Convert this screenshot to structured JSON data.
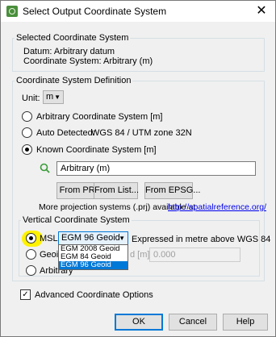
{
  "window": {
    "title": "Select Output Coordinate System",
    "close_glyph": "✕"
  },
  "selected_cs": {
    "legend": "Selected Coordinate System",
    "datum": "Datum: Arbitrary datum",
    "cs": "Coordinate System: Arbitrary (m)"
  },
  "definition": {
    "legend": "Coordinate System Definition",
    "unit_label": "Unit:",
    "unit_value": "m",
    "arbitrary_label": "Arbitrary Coordinate System [m]",
    "auto_label": "Auto Detected:",
    "auto_value": "WGS 84 / UTM zone 32N",
    "known_label": "Known Coordinate System [m]",
    "search_value": "Arbitrary (m)",
    "from_prj": "From PRJ...",
    "from_list": "From List...",
    "from_epsg": "From EPSG...",
    "more_text": "More projection systems (.prj) available at",
    "more_link": "http://spatialreference.org/"
  },
  "vertical": {
    "legend": "Vertical Coordinate System",
    "msl_label": "MSL",
    "geoid_selected": "EGM 96 Geoid",
    "expressed_text": "Expressed in metre above WGS 84",
    "geoid_label": "Geoid",
    "geoid_unit_partial": "d [m]",
    "geoid_value": "0.000",
    "arbitrary_label": "Arbitrary",
    "options": [
      "EGM 2008 Geoid",
      "EGM 84 Geoid",
      "EGM 96 Geoid"
    ]
  },
  "advanced": {
    "label": "Advanced Coordinate Options",
    "check": "✓"
  },
  "buttons": {
    "ok": "OK",
    "cancel": "Cancel",
    "help": "Help"
  },
  "icons": {
    "search": "search-icon",
    "app": "app-icon",
    "dropdown": "chevron-down-icon"
  },
  "colors": {
    "highlight": "#fff200",
    "selection": "#0078d7",
    "link": "#0000ee"
  }
}
